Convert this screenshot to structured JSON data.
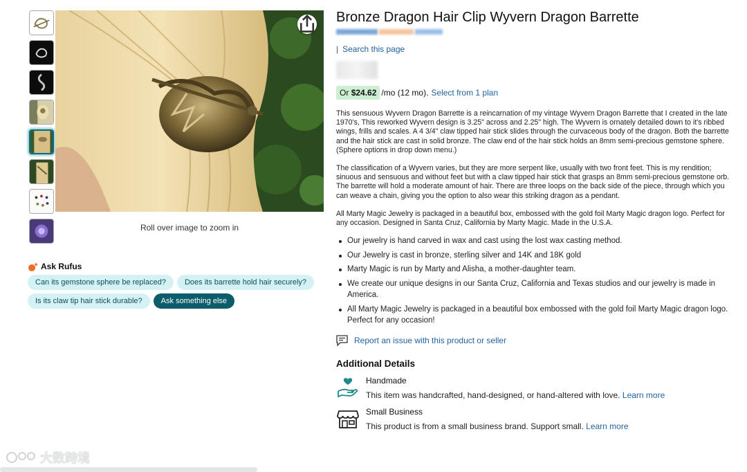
{
  "product": {
    "title": "Bronze Dragon Hair Clip Wyvern Dragon Barrette",
    "search_page": "Search this page"
  },
  "gallery": {
    "thumbnails": [
      "thumbnail-1",
      "thumbnail-2",
      "thumbnail-3",
      "thumbnail-4",
      "thumbnail-5",
      "thumbnail-6",
      "thumbnail-7",
      "thumbnail-8"
    ],
    "active_index": 4,
    "zoom_hint": "Roll over image to zoom in",
    "share_icon": "share-icon"
  },
  "rufus": {
    "title": "Ask Rufus",
    "questions": [
      "Can its gemstone sphere be replaced?",
      "Does its barrette hold hair securely?",
      "Is its claw tip hair stick durable?"
    ],
    "ask_else": "Ask something else"
  },
  "plan": {
    "or": "Or",
    "price": "$24.62",
    "term": "/mo (12 mo).",
    "link": "Select from 1 plan"
  },
  "description": [
    "This sensuous Wyvern Dragon Barrette is a reincarnation of my vintage Wyvern Dragon Barrette that I created in the late 1970's, This reworked Wyvern design is 3.25\" across and 2.25\" high. The Wyvern is ornately detailed down to it's ribbed wings, frills and scales. A 4 3/4\" claw tipped hair stick slides through the curvaceous body of the dragon. Both the barrette and the hair stick are cast in solid bronze. The claw end of the hair stick holds an 8mm semi-precious gemstone sphere. (Sphere options in drop down menu.)",
    "The classification of a Wyvern varies, but they are more serpent like, usually with two front feet. This is my rendition; sinuous and sensuous and without feet but with a claw tipped hair stick that grasps an 8mm semi-precious gemstone orb. The barrette will hold a moderate amount of hair. There are three loops on the back side of the piece, through which you can weave a chain, giving you the option to also wear this striking dragon as a pendant.",
    "All Marty Magic Jewelry is packaged in a beautiful box, embossed with the gold foil Marty Magic dragon logo. Perfect for any occasion. Designed in Santa Cruz, California by Marty Magic. Made in the U.S.A."
  ],
  "bullets": [
    "Our jewelry is hand carved in wax and cast using the lost wax casting method.",
    "Our Jewelry is cast in bronze, sterling silver and 14K and 18K gold",
    "Marty Magic is run by Marty and Alisha, a mother-daughter team.",
    "We create our unique designs in our Santa Cruz, California and Texas studios and our jewelry is made in America.",
    "All Marty Magic Jewelry is packaged in a beautiful box embossed with the gold foil Marty Magic dragon logo. Perfect for any occasion!"
  ],
  "report": "Report an issue with this product or seller",
  "additional": {
    "heading": "Additional Details",
    "handmade": {
      "title": "Handmade",
      "text": "This item was handcrafted, hand-designed, or hand-altered with love.",
      "link": "Learn more"
    },
    "small_business": {
      "title": "Small Business",
      "text": "This product is from a small business brand. Support small.",
      "link": "Learn more"
    }
  },
  "watermark": "大数跨境",
  "colors": {
    "link": "#2162a1",
    "chip": "#d4f1f4",
    "chip_dark": "#0b5d6b",
    "plan_badge": "#cdeed1",
    "active_thumb": "#007185"
  }
}
